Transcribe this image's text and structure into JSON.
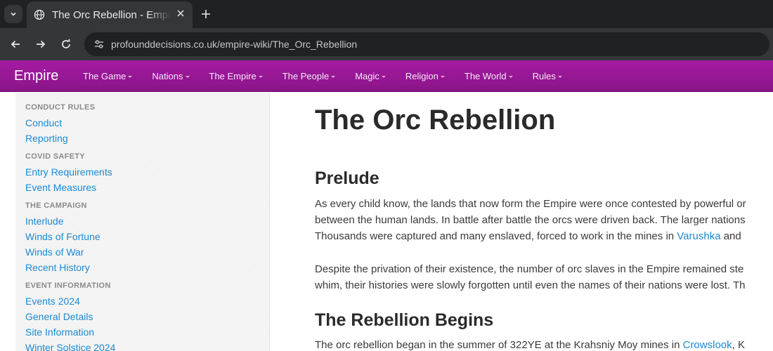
{
  "browser": {
    "tab_title": "The Orc Rebellion - Empire Wiki",
    "url": "profounddecisions.co.uk/empire-wiki/The_Orc_Rebellion",
    "icons": {
      "tab_list": "chevron-down-icon",
      "favicon": "globe-icon",
      "close": "close-icon",
      "new_tab": "plus-icon",
      "back": "back-arrow-icon",
      "forward": "forward-arrow-icon",
      "reload": "reload-icon",
      "site_info": "tune-icon"
    }
  },
  "site": {
    "brand": "Empire",
    "accent_color": "#9b199a",
    "menu": [
      {
        "label": "The Game"
      },
      {
        "label": "Nations"
      },
      {
        "label": "The Empire"
      },
      {
        "label": "The People"
      },
      {
        "label": "Magic"
      },
      {
        "label": "Religion"
      },
      {
        "label": "The World"
      },
      {
        "label": "Rules"
      }
    ]
  },
  "sidebar": {
    "sections": [
      {
        "heading": "CONDUCT RULES",
        "links": [
          "Conduct",
          "Reporting"
        ]
      },
      {
        "heading": "COVID SAFETY",
        "links": [
          "Entry Requirements",
          "Event Measures"
        ]
      },
      {
        "heading": "THE CAMPAIGN",
        "links": [
          "Interlude",
          "Winds of Fortune",
          "Winds of War",
          "Recent History"
        ]
      },
      {
        "heading": "EVENT INFORMATION",
        "links": [
          "Events 2024",
          "General Details",
          "Site Information",
          "Winter Solstice 2024"
        ]
      }
    ]
  },
  "main": {
    "title": "The Orc Rebellion",
    "prelude_heading": "Prelude",
    "prelude_p1": {
      "line1": "As every child know, the lands that now form the Empire were once contested by powerful or",
      "line2": "between the human lands. In battle after battle the orcs were driven back. The larger nations",
      "line3_pre": "Thousands were captured and many enslaved, forced to work in the mines in ",
      "line3_link": "Varushka",
      "line3_post": " and"
    },
    "prelude_p2": {
      "line1": "Despite the privation of their existence, the number of orc slaves in the Empire remained ste",
      "line2": "whim, their histories were slowly forgotten until even the names of their nations were lost. Th"
    },
    "rebellion_heading": "The Rebellion Begins",
    "rebellion_p1": {
      "pre": "The orc rebellion began in the summer of 322YE at the Krahsniy Moy mines in ",
      "link": "Crowslook",
      "post": ", K"
    }
  }
}
